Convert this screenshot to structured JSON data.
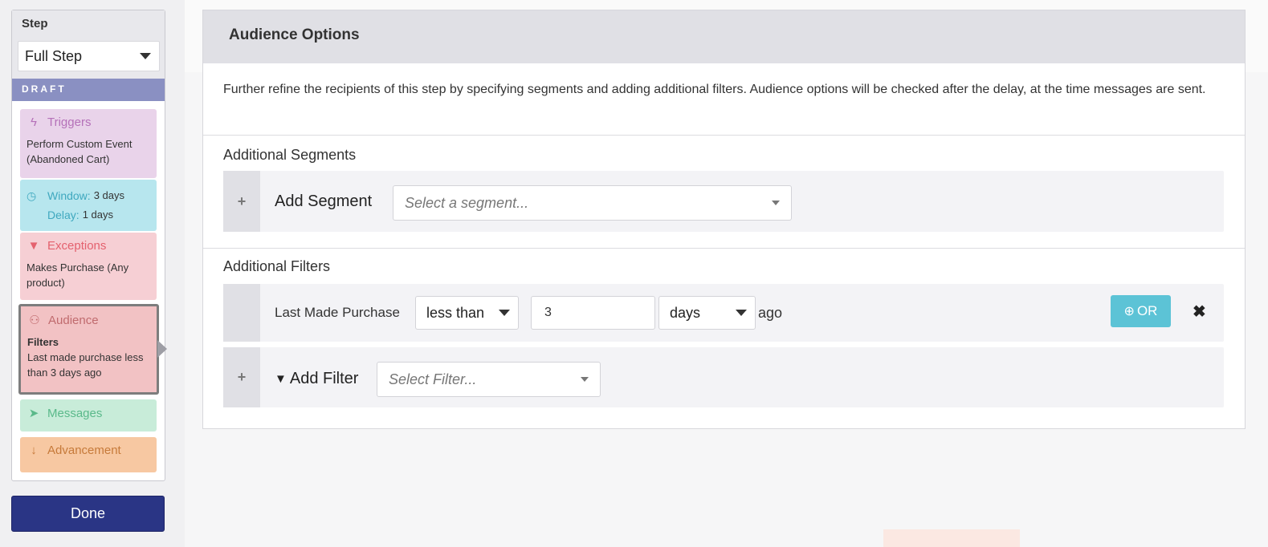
{
  "step_panel": {
    "title": "Step",
    "select_value": "Full Step",
    "status": "DRAFT",
    "triggers": {
      "label": "Triggers",
      "text": "Perform Custom Event (Abandoned Cart)"
    },
    "window": {
      "window_label": "Window:",
      "window_value": "3 days",
      "delay_label": "Delay:",
      "delay_value": "1 days"
    },
    "exceptions": {
      "label": "Exceptions",
      "text": "Makes Purchase (Any product)"
    },
    "audience": {
      "label": "Audience",
      "subhead": "Filters",
      "text": "Last made purchase less than 3 days ago"
    },
    "messages": {
      "label": "Messages"
    },
    "advancement": {
      "label": "Advancement"
    },
    "done_label": "Done"
  },
  "audience_options": {
    "title": "Audience Options",
    "description": "Further refine the recipients of this step by specifying segments and adding additional filters. Audience options will be checked after the delay, at the time messages are sent.",
    "segments": {
      "heading": "Additional Segments",
      "add_label": "Add Segment",
      "placeholder": "Select a segment..."
    },
    "filters": {
      "heading": "Additional Filters",
      "filter": {
        "name": "Last Made Purchase",
        "comparator": "less than",
        "value": "3",
        "unit": "days",
        "suffix": "ago",
        "or_label": "OR"
      },
      "add_label": "Add Filter",
      "placeholder": "Select Filter..."
    }
  },
  "colors": {
    "draft": "#8a90c2",
    "triggers": "#e9d3ea",
    "window": "#b7e6ee",
    "exceptions": "#f6cfd4",
    "audience": "#f2c2c4",
    "messages": "#c8ecd9",
    "advancement": "#f7c8a2",
    "done": "#2a3585",
    "or_button": "#5cc3d6"
  },
  "icons": {
    "triggers": "bolt-icon",
    "window": "clock-icon",
    "exceptions": "funnel-icon",
    "audience": "users-icon",
    "messages": "paper-plane-icon",
    "advancement": "arrow-down-icon",
    "or": "plus-circle-icon",
    "remove": "close-icon"
  }
}
